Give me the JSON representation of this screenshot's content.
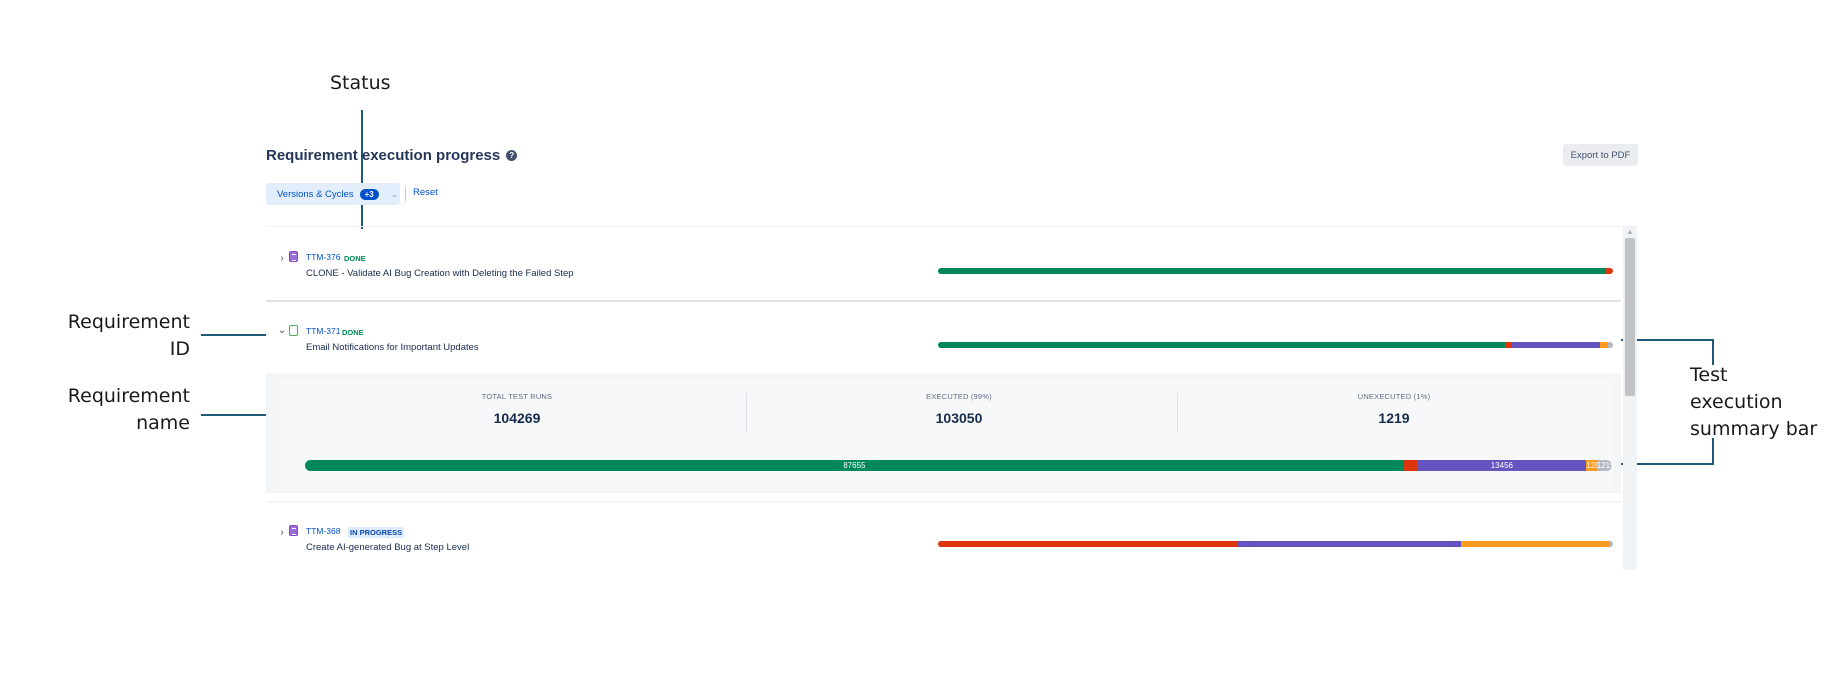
{
  "annotations": {
    "status": "Status",
    "requirement_id_line1": "Requirement",
    "requirement_id_line2": "ID",
    "requirement_name_line1": "Requirement",
    "requirement_name_line2": "name",
    "summary_bar_line1": "Test",
    "summary_bar_line2": "execution",
    "summary_bar_line3": "summary bar"
  },
  "page": {
    "title": "Requirement execution progress",
    "help_icon": "?",
    "export_label": "Export to PDF"
  },
  "filters": {
    "versions_label": "Versions & Cycles",
    "versions_count": "+3",
    "reset_label": "Reset"
  },
  "colors": {
    "passed": "#00875a",
    "failed": "#de350b",
    "blocked": "#6554c0",
    "in_progress": "#ff991f",
    "unexecuted": "#b3b9c4"
  },
  "requirements": [
    {
      "id": "TTM-376",
      "status": "DONE",
      "name": "CLONE - Validate AI Bug Creation with Deleting the Failed Step",
      "icon": "story-icon",
      "expanded": false,
      "bar_segments": [
        {
          "kind": "passed",
          "percent": 99.0
        },
        {
          "kind": "failed",
          "percent": 1.0
        }
      ]
    },
    {
      "id": "TTM-371",
      "status": "DONE",
      "name": "Email Notifications for Important Updates",
      "icon": "bookmark-icon",
      "expanded": true,
      "bar_segments": [
        {
          "kind": "passed",
          "percent": 84.0
        },
        {
          "kind": "failed",
          "percent": 1.0
        },
        {
          "kind": "blocked",
          "percent": 13.0
        },
        {
          "kind": "in_progress",
          "percent": 1.2
        },
        {
          "kind": "unexecuted",
          "percent": 0.8
        }
      ],
      "summary": {
        "total_label": "TOTAL TEST RUNS",
        "total_value": "104269",
        "executed_label": "EXECUTED (99%)",
        "executed_value": "103050",
        "unexecuted_label": "UNEXECUTED (1%)",
        "unexecuted_value": "1219",
        "segments": [
          {
            "kind": "passed",
            "value": 87655,
            "label": "87655"
          },
          {
            "kind": "failed",
            "value": 1100,
            "label": ""
          },
          {
            "kind": "blocked",
            "value": 13456,
            "label": "13456"
          },
          {
            "kind": "in_progress",
            "value": 839,
            "label": "1283"
          },
          {
            "kind": "unexecuted",
            "value": 1219,
            "label": "1219"
          }
        ]
      }
    },
    {
      "id": "TTM-368",
      "status": "IN PROGRESS",
      "name": "Create AI-generated Bug at Step Level",
      "icon": "story-icon",
      "expanded": false,
      "bar_segments": [
        {
          "kind": "failed",
          "percent": 44.5
        },
        {
          "kind": "blocked",
          "percent": 33.0
        },
        {
          "kind": "in_progress",
          "percent": 22.0
        },
        {
          "kind": "unexecuted",
          "percent": 0.5
        }
      ]
    }
  ]
}
